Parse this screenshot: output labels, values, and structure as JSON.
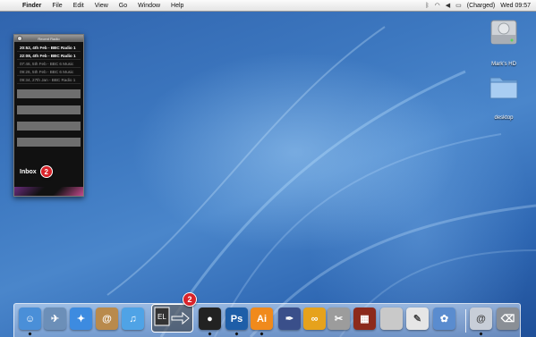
{
  "menubar": {
    "apple": "",
    "app_name": "Finder",
    "menus": [
      "File",
      "Edit",
      "View",
      "Go",
      "Window",
      "Help"
    ],
    "battery_status": "(Charged)",
    "clock": "Wed 09:57"
  },
  "desktop_icons": [
    {
      "label": "Mark's HD",
      "icon": "hard-drive-icon"
    },
    {
      "label": "desktop",
      "icon": "folder-icon"
    }
  ],
  "widget": {
    "title": "Recent Radio",
    "rows": [
      {
        "text": "20:52, 4th Feb - BBC Radio 1",
        "dim": false
      },
      {
        "text": "22:08, 4th Feb - BBC Radio 1",
        "dim": false
      },
      {
        "text": "07:46, 5th Feb - BBC 6 Music",
        "dim": true
      },
      {
        "text": "09:26, 5th Feb - BBC 6 Music",
        "dim": true
      },
      {
        "text": "09:34, 27th Jan - BBC Radio 1",
        "dim": true
      }
    ],
    "inbox_label": "Inbox",
    "inbox_count": "2"
  },
  "dock": {
    "badge_count": "2",
    "highlight_label": "EL",
    "items": [
      {
        "name": "finder-icon",
        "glyph": "☺",
        "color": "#4a8fd8"
      },
      {
        "name": "preview-icon",
        "glyph": "✈",
        "color": "#6c8fb8"
      },
      {
        "name": "safari-icon",
        "glyph": "✦",
        "color": "#3d8be0"
      },
      {
        "name": "address-book-icon",
        "glyph": "@",
        "color": "#b98a4c"
      },
      {
        "name": "itunes-icon",
        "glyph": "♫",
        "color": "#4fa3e6"
      },
      {
        "name": "photo-booth-icon",
        "glyph": "●",
        "color": "#222222"
      },
      {
        "name": "photoshop-icon",
        "glyph": "Ps",
        "color": "#1e5ea8"
      },
      {
        "name": "illustrator-icon",
        "glyph": "Ai",
        "color": "#f08a1c"
      },
      {
        "name": "pen-tool-icon",
        "glyph": "✒",
        "color": "#3a4f8a"
      },
      {
        "name": "chain-app-icon",
        "glyph": "∞",
        "color": "#e6a21c"
      },
      {
        "name": "script-editor-icon",
        "glyph": "✂",
        "color": "#9c9c9c"
      },
      {
        "name": "photo-app-icon",
        "glyph": "▦",
        "color": "#8c2a1c"
      },
      {
        "name": "system-prefs-icon",
        "glyph": "",
        "color": "#c9c9c9"
      },
      {
        "name": "textedit-icon",
        "glyph": "✎",
        "color": "#e6e6e6"
      },
      {
        "name": "image-capture-icon",
        "glyph": "✿",
        "color": "#5a8ccf"
      },
      {
        "name": "mail-icon",
        "glyph": "@",
        "color": "#c8ced8"
      },
      {
        "name": "trash-icon",
        "glyph": "⌫",
        "color": "#8a8f96"
      }
    ]
  }
}
